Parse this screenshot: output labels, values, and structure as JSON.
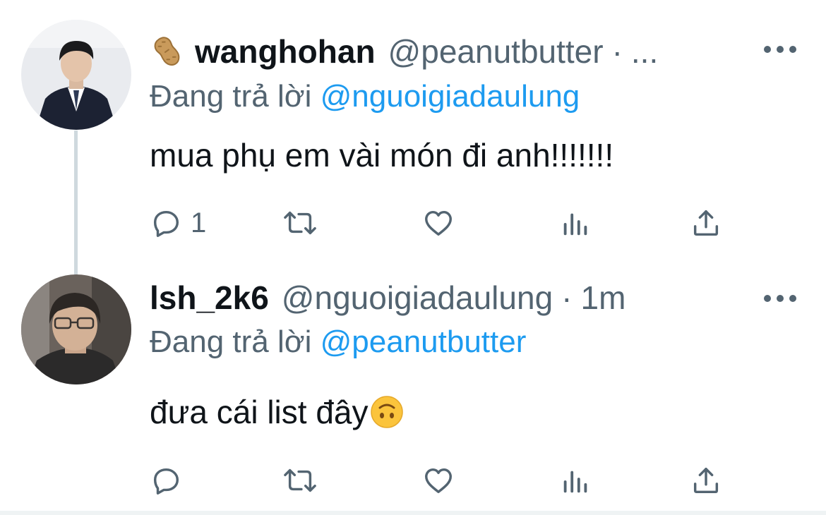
{
  "tweets": [
    {
      "display_name": "wanghohan",
      "handle": "@peanutbutter",
      "separator": "·",
      "time": "...",
      "replying_prefix": "Đang trả lời ",
      "replying_to": "@nguoigiadaulung",
      "text": "mua phụ em vài món đi anh!!!!!!!",
      "name_emoji": "peanut-icon",
      "actions": {
        "reply_count": "1"
      }
    },
    {
      "display_name": "lsh_2k6",
      "handle": "@nguoigiadaulung",
      "separator": "·",
      "time": "1m",
      "replying_prefix": "Đang trả lời ",
      "replying_to": "@peanutbutter",
      "text": "đưa cái list đây",
      "text_emoji": "upside-down-face-emoji",
      "actions": {
        "reply_count": ""
      }
    }
  ],
  "colors": {
    "text": "#0f1419",
    "secondary": "#536471",
    "link": "#1d9bf0",
    "thread_line": "#cfd9de"
  }
}
